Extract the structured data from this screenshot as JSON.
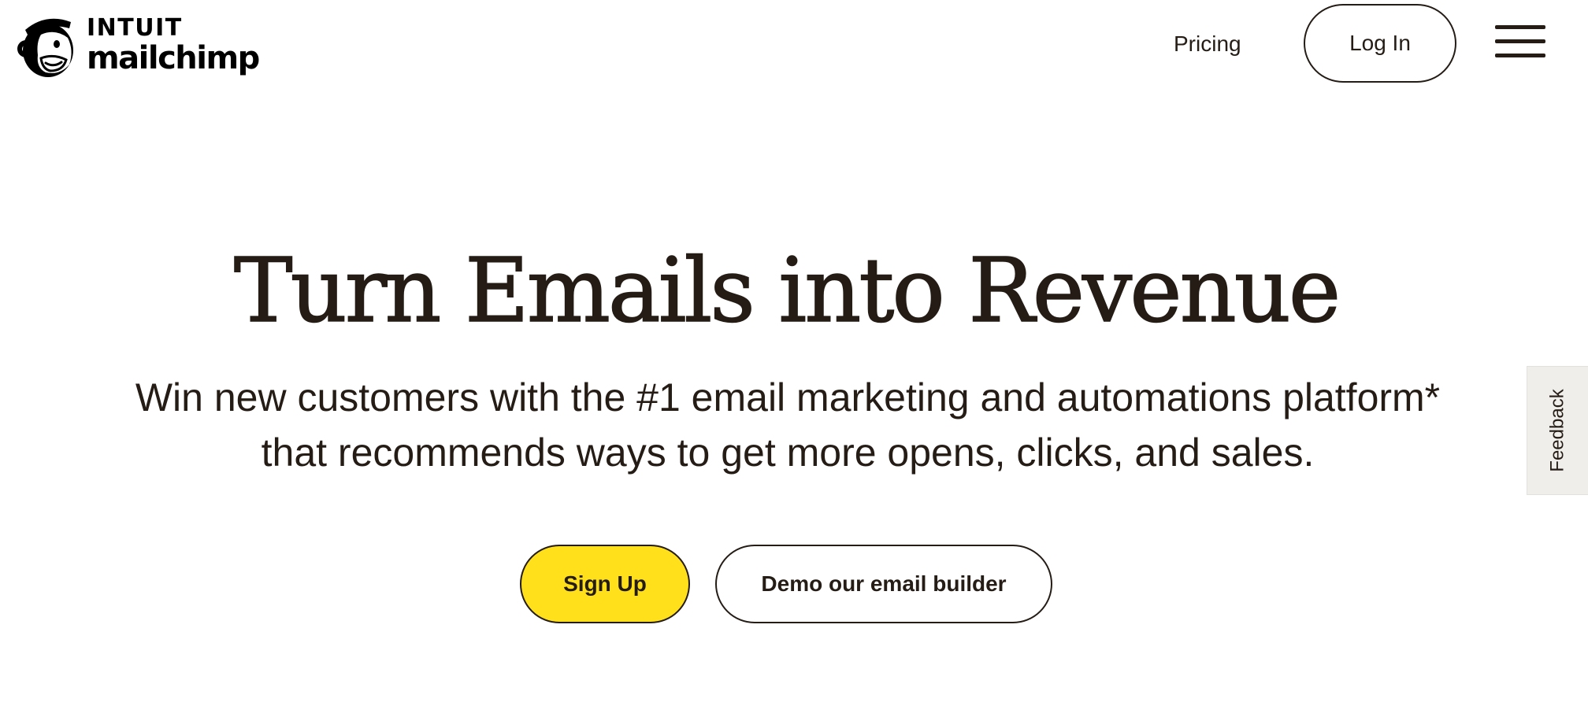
{
  "header": {
    "logo": {
      "brand_line1": "INTUIT",
      "brand_line2": "mailchimp",
      "icon": "mailchimp-freddie-logo-icon"
    },
    "nav": {
      "pricing_label": "Pricing",
      "login_label": "Log In",
      "menu_icon": "hamburger-menu-icon"
    }
  },
  "hero": {
    "title": "Turn Emails into Revenue",
    "subtitle": "Win new customers with the #1 email marketing and automations platform* that recommends ways to get more opens, clicks, and sales.",
    "buttons": {
      "signup_label": "Sign Up",
      "demo_label": "Demo our email builder"
    }
  },
  "feedback": {
    "label": "Feedback"
  },
  "colors": {
    "text": "#241c15",
    "accent_yellow": "#ffe01b",
    "background": "#ffffff",
    "feedback_bg": "#efeeea"
  }
}
